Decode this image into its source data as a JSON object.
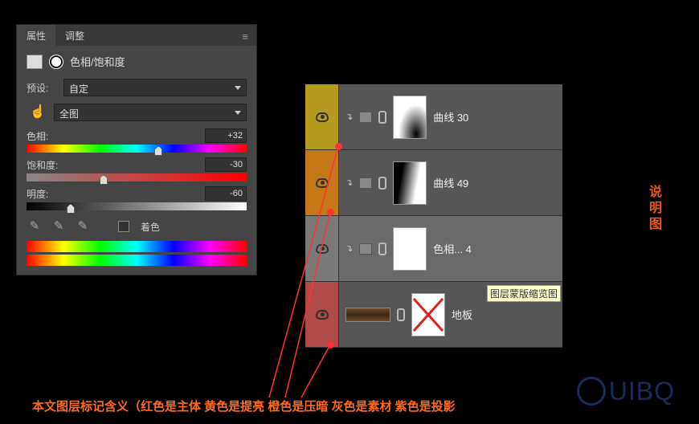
{
  "panel": {
    "tabs": {
      "properties": "属性",
      "adjust": "调整"
    },
    "title": "色相/饱和度",
    "preset_label": "预设:",
    "preset_value": "自定",
    "range_value": "全图",
    "hue": {
      "label": "色相:",
      "value": "+32",
      "pos": 60
    },
    "sat": {
      "label": "饱和度:",
      "value": "-30",
      "pos": 35
    },
    "lig": {
      "label": "明度:",
      "value": "-60",
      "pos": 20
    },
    "colorize": "着色"
  },
  "layers": [
    {
      "color": "yellow",
      "name": "曲线 30",
      "mask": "grad1",
      "adj": true
    },
    {
      "color": "orange",
      "name": "曲线 49",
      "mask": "grad2",
      "adj": true
    },
    {
      "color": "gray",
      "name": "色相... 4",
      "mask": "white",
      "adj": true,
      "sel": true
    },
    {
      "color": "red",
      "name": "地板",
      "mask": "x",
      "adj": false,
      "tooltip": "图层蒙版缩览图"
    }
  ],
  "side_note": "说明图",
  "caption": "本文图层标记含义（红色是主体  黄色是提亮  橙色是压暗  灰色是素材  紫色是投影",
  "watermark": "UIBQ"
}
